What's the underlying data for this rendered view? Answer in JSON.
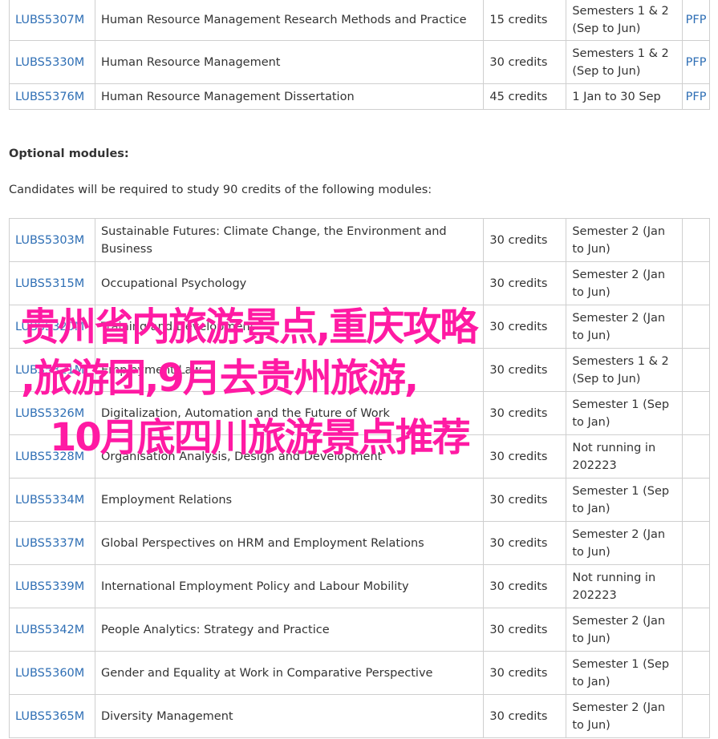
{
  "core_modules": [
    {
      "code": "LUBS5307M",
      "title": "Human Resource Management Research Methods and Practice",
      "credits": "15 credits",
      "semester": "Semesters 1 & 2 (Sep to Jun)",
      "pfp": "PFP"
    },
    {
      "code": "LUBS5330M",
      "title": "Human Resource Management",
      "credits": "30 credits",
      "semester": "Semesters 1 & 2 (Sep to Jun)",
      "pfp": "PFP"
    },
    {
      "code": "LUBS5376M",
      "title": "Human Resource Management Dissertation",
      "credits": "45 credits",
      "semester": "1 Jan to 30 Sep",
      "pfp": "PFP"
    }
  ],
  "optional": {
    "heading": "Optional modules:",
    "intro": "Candidates will be required to study 90 credits of the following modules:"
  },
  "optional_modules": [
    {
      "code": "LUBS5303M",
      "title": "Sustainable Futures: Climate Change, the Environment and Business",
      "credits": "30 credits",
      "semester": "Semester 2 (Jan to Jun)"
    },
    {
      "code": "LUBS5315M",
      "title": "Occupational Psychology",
      "credits": "30 credits",
      "semester": "Semester 2 (Jan to Jun)"
    },
    {
      "code": "LUBS5320M",
      "title": "Training and Development",
      "credits": "30 credits",
      "semester": "Semester 2 (Jan to Jun)"
    },
    {
      "code": "LUBS5321M",
      "title": "Employment Law",
      "credits": "30 credits",
      "semester": "Semesters 1 & 2 (Sep to Jun)"
    },
    {
      "code": "LUBS5326M",
      "title": "Digitalization, Automation and the Future of Work",
      "credits": "30 credits",
      "semester": "Semester 1 (Sep to Jan)"
    },
    {
      "code": "LUBS5328M",
      "title": "Organisation Analysis, Design and Development",
      "credits": "30 credits",
      "semester": "Not running in 202223"
    },
    {
      "code": "LUBS5334M",
      "title": "Employment Relations",
      "credits": "30 credits",
      "semester": "Semester 1 (Sep to Jan)"
    },
    {
      "code": "LUBS5337M",
      "title": "Global Perspectives on HRM and Employment Relations",
      "credits": "30 credits",
      "semester": "Semester 2 (Jan to Jun)"
    },
    {
      "code": "LUBS5339M",
      "title": "International Employment Policy and Labour Mobility",
      "credits": "30 credits",
      "semester": "Not running in 202223"
    },
    {
      "code": "LUBS5342M",
      "title": "People Analytics: Strategy and Practice",
      "credits": "30 credits",
      "semester": "Semester 2 (Jan to Jun)"
    },
    {
      "code": "LUBS5360M",
      "title": "Gender and Equality at Work in Comparative Perspective",
      "credits": "30 credits",
      "semester": "Semester 1 (Sep to Jan)"
    },
    {
      "code": "LUBS5365M",
      "title": "Diversity Management",
      "credits": "30 credits",
      "semester": "Semester 2 (Jan to Jun)"
    }
  ],
  "overlay": {
    "line1": "贵州省内旅游景点,重庆攻略",
    "line2": ",旅游团,9月去贵州旅游,",
    "line3": "10月底四川旅游景点推荐",
    "color": "#ff1aa3"
  },
  "colors": {
    "link": "#2f6fb5",
    "border": "#cfcfcf",
    "text": "#333333"
  }
}
